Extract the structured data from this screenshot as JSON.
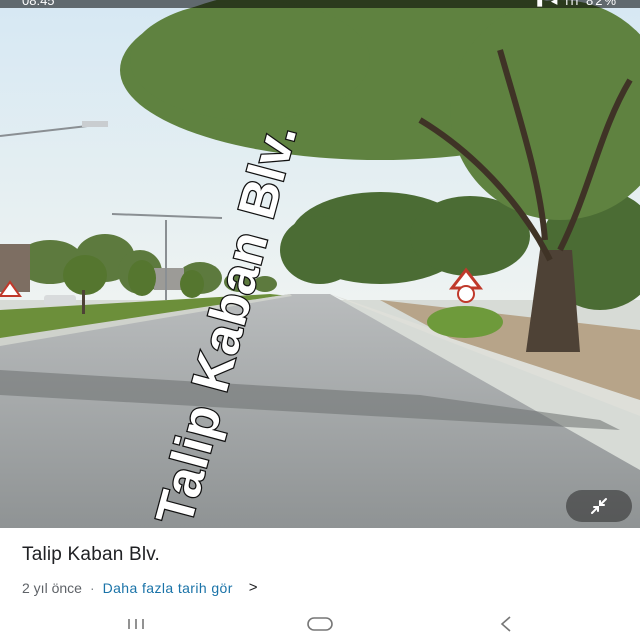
{
  "status_bar": {
    "time": "08:45",
    "right_indicators": "▮ ◂ ıll 82%"
  },
  "street_view": {
    "road_overlay_label": "Talip Kaban Blv.",
    "collapse_button_icon": "collapse-arrows-icon"
  },
  "place": {
    "title": "Talip Kaban Blv.",
    "age": "2 yıl önce",
    "separator": "·",
    "history_link": "Daha fazla tarih gör",
    "history_chevron": ">"
  },
  "nav": {
    "recent_icon": "recent-apps-icon",
    "home_icon": "home-icon",
    "back_icon": "back-icon"
  },
  "colors": {
    "link": "#1a73a8",
    "title": "#202124",
    "meta": "#5f6368"
  }
}
